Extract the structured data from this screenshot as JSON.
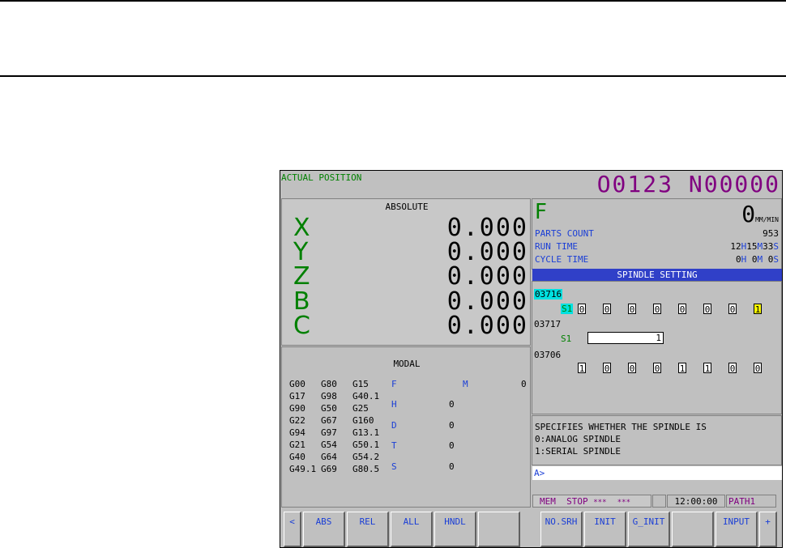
{
  "header": {
    "title": "ACTUAL POSITION",
    "program": "O0123 N00000"
  },
  "position": {
    "title": "ABSOLUTE",
    "axes": [
      {
        "name": "X",
        "value": "0.000"
      },
      {
        "name": "Y",
        "value": "0.000"
      },
      {
        "name": "Z",
        "value": "0.000"
      },
      {
        "name": "B",
        "value": "0.000"
      },
      {
        "name": "C",
        "value": "0.000"
      }
    ]
  },
  "feed": {
    "label": "F",
    "value": "0",
    "unit": "MM/MIN"
  },
  "counters": {
    "parts_label": "PARTS COUNT",
    "parts_value": "953",
    "run_label": "RUN TIME",
    "run_h": "12",
    "run_m": "15",
    "run_s": "33",
    "cycle_label": "CYCLE TIME",
    "cycle_h": "0",
    "cycle_m": "0",
    "cycle_s": "0",
    "h_unit": "H",
    "m_unit": "M",
    "s_unit": "S"
  },
  "spindle": {
    "title": "SPINDLE SETTING",
    "p1_num": "03716",
    "p1_sub": "S1",
    "p1_bits": [
      "0",
      "0",
      "0",
      "0",
      "0",
      "0",
      "0",
      "1"
    ],
    "p2_num": "03717",
    "p2_sub": "S1",
    "p2_value": "1",
    "p3_num": "03706",
    "p3_bits": [
      "1",
      "0",
      "0",
      "0",
      "1",
      "1",
      "0",
      "0"
    ]
  },
  "help": {
    "line1": "SPECIFIES WHETHER THE SPINDLE IS",
    "line2": "0:ANALOG SPINDLE",
    "line3": "1:SERIAL SPINDLE"
  },
  "input_prompt": "A>",
  "status": {
    "mode": "MEM",
    "state": "STOP",
    "stars1": "***",
    "stars2": "***",
    "time": "12:00:00",
    "path": "PATH1"
  },
  "modal": {
    "title": "MODAL",
    "gcodes": [
      [
        "G00",
        "G80",
        "G15"
      ],
      [
        "G17",
        "G98",
        "G40.1"
      ],
      [
        "G90",
        "G50",
        "G25"
      ],
      [
        "G22",
        "G67",
        "G160"
      ],
      [
        "G94",
        "G97",
        "G13.1"
      ],
      [
        "G21",
        "G54",
        "G50.1"
      ],
      [
        "G40",
        "G64",
        "G54.2"
      ],
      [
        "G49.1",
        "G69",
        "G80.5"
      ]
    ],
    "f_label": "F",
    "m_label": "M",
    "m_value": "0",
    "h_label": "H",
    "h_value": "0",
    "d_label": "D",
    "d_value": "0",
    "t_label": "T",
    "t_value": "0",
    "s_label": "S",
    "s_value": "0"
  },
  "softkeys": {
    "left_arrow": "<",
    "abs": "ABS",
    "rel": "REL",
    "all": "ALL",
    "hndl": "HNDL",
    "blank1": "",
    "nosrh": "NO.SRH",
    "init": "INIT",
    "ginit": "G_INIT",
    "blank2": "",
    "input": "INPUT",
    "plus": "+"
  },
  "colors": {
    "program": "#800080",
    "axis": "#008000",
    "label_blue": "#1a3ed6",
    "title_bar": "#3040c8",
    "highlight_cyan": "#00e0e0",
    "highlight_yellow": "#ffff00"
  }
}
